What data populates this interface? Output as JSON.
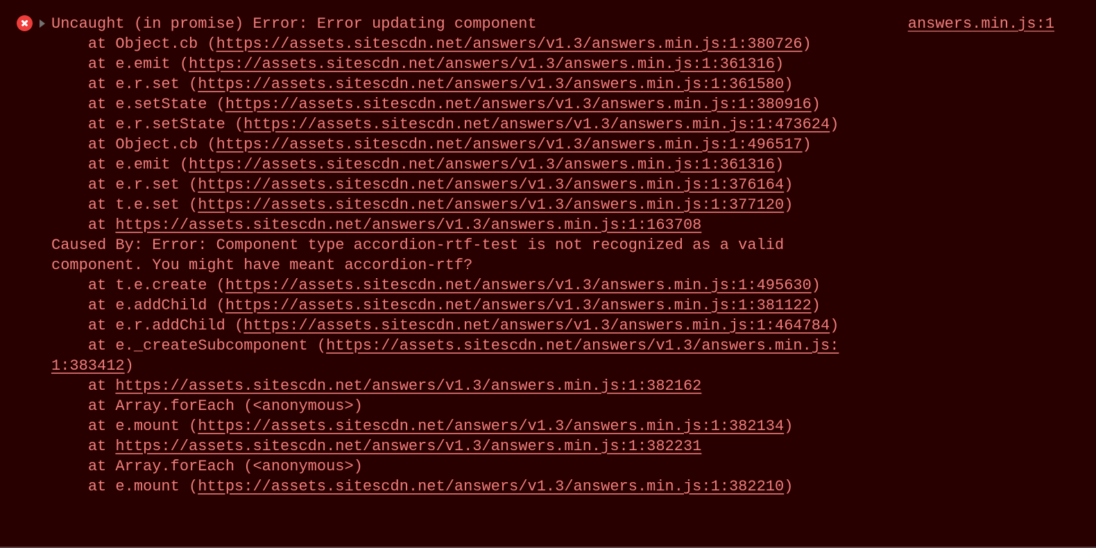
{
  "source_link": "answers.min.js:1",
  "error_header": "Uncaught (in promise) Error: Error updating component",
  "stack1": [
    {
      "fn": "Object.cb",
      "url": "https://assets.sitescdn.net/answers/v1.3/answers.min.js:1:380726"
    },
    {
      "fn": "e.emit",
      "url": "https://assets.sitescdn.net/answers/v1.3/answers.min.js:1:361316"
    },
    {
      "fn": "e.r.set",
      "url": "https://assets.sitescdn.net/answers/v1.3/answers.min.js:1:361580"
    },
    {
      "fn": "e.setState",
      "url": "https://assets.sitescdn.net/answers/v1.3/answers.min.js:1:380916"
    },
    {
      "fn": "e.r.setState",
      "url": "https://assets.sitescdn.net/answers/v1.3/answers.min.js:1:473624"
    },
    {
      "fn": "Object.cb",
      "url": "https://assets.sitescdn.net/answers/v1.3/answers.min.js:1:496517"
    },
    {
      "fn": "e.emit",
      "url": "https://assets.sitescdn.net/answers/v1.3/answers.min.js:1:361316"
    },
    {
      "fn": "e.r.set",
      "url": "https://assets.sitescdn.net/answers/v1.3/answers.min.js:1:376164"
    },
    {
      "fn": "t.e.set",
      "url": "https://assets.sitescdn.net/answers/v1.3/answers.min.js:1:377120"
    },
    {
      "fn": "",
      "url": "https://assets.sitescdn.net/answers/v1.3/answers.min.js:1:163708"
    }
  ],
  "caused_by_1": "Caused By: Error: Component type accordion-rtf-test is not recognized as a valid ",
  "caused_by_2": "component. You might have meant accordion-rtf?",
  "stack2_part1": [
    {
      "fn": "t.e.create",
      "url": "https://assets.sitescdn.net/answers/v1.3/answers.min.js:1:495630"
    },
    {
      "fn": "e.addChild",
      "url": "https://assets.sitescdn.net/answers/v1.3/answers.min.js:1:381122"
    },
    {
      "fn": "e.r.addChild",
      "url": "https://assets.sitescdn.net/answers/v1.3/answers.min.js:1:464784"
    }
  ],
  "wrap_fn": "e._createSubcomponent",
  "wrap_url_a": "https://assets.sitescdn.net/answers/v1.3/answers.min.js:",
  "wrap_url_b": "1:383412",
  "stack2_part2": [
    {
      "fn": "",
      "url": "https://assets.sitescdn.net/answers/v1.3/answers.min.js:1:382162"
    },
    {
      "fn": "Array.forEach",
      "raw": "<anonymous>"
    },
    {
      "fn": "e.mount",
      "url": "https://assets.sitescdn.net/answers/v1.3/answers.min.js:1:382134"
    },
    {
      "fn": "",
      "url": "https://assets.sitescdn.net/answers/v1.3/answers.min.js:1:382231"
    },
    {
      "fn": "Array.forEach",
      "raw": "<anonymous>"
    },
    {
      "fn": "e.mount",
      "url": "https://assets.sitescdn.net/answers/v1.3/answers.min.js:1:382210"
    }
  ],
  "at": "at ",
  "indent": "    "
}
